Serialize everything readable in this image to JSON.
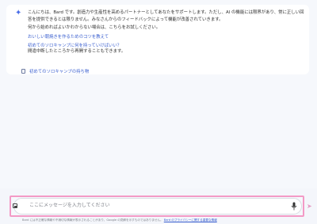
{
  "bard": {
    "intro": "こんにちは、Bard です。創造力や生産性を高めるパートナーとしてあなたをサポートします。ただし、AI の機能には限界があり、常に正しい回答を提供できるとは限りません。みなさんからのフィードバックによって機能が改善されていきます。",
    "prompt_hint": "何から始めればよいかわからない場合は、こちらをお試しください。",
    "suggestions": [
      "おいしい朝焼きを作るためのコツを教えて",
      "初めてのソロキャンプに何を持っていけばいい？"
    ],
    "resume_text": "間違中断したところから再開することもできます。",
    "draft_link": "初めてのソロキャンプの持ち物"
  },
  "input": {
    "placeholder": "ここにメッセージを入力してください"
  },
  "footer": {
    "disclaimer": "Bard には不正確な情報や不適切な情報が表示されることがあり、Google の見解を示すものではありません。",
    "link": "Bard のプライバシーに関する重要な情報"
  },
  "colors": {
    "accent": "#3a5fcf",
    "highlight": "#f39ac6",
    "background": "#f6f8fc"
  },
  "icons": {
    "bard": "sparkle-icon",
    "upload": "image-upload-icon",
    "mic": "microphone-icon",
    "send": "send-icon",
    "draft": "document-icon"
  }
}
